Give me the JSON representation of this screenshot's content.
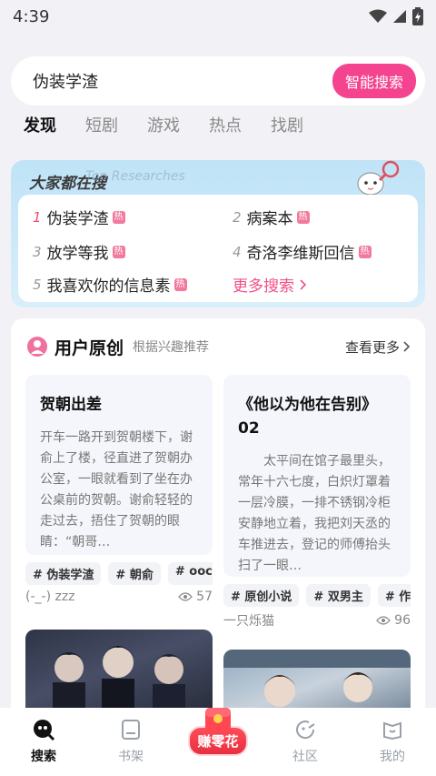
{
  "status_bar": {
    "time": "4:39"
  },
  "search": {
    "query": "伪装学渣",
    "button_label": "智能搜索"
  },
  "tabs": [
    {
      "label": "发现",
      "active": true
    },
    {
      "label": "短剧"
    },
    {
      "label": "游戏"
    },
    {
      "label": "热点"
    },
    {
      "label": "找剧"
    }
  ],
  "hot": {
    "title": "大家都在搜",
    "watermark": "Top Researches",
    "badge": "热",
    "items": [
      {
        "rank": "1",
        "text": "伪装学渣"
      },
      {
        "rank": "2",
        "text": "病案本"
      },
      {
        "rank": "3",
        "text": "放学等我"
      },
      {
        "rank": "4",
        "text": "奇洛李维斯回信"
      },
      {
        "rank": "5",
        "text": "我喜欢你的信息素"
      }
    ],
    "more": "更多搜索"
  },
  "ugc": {
    "title": "用户原创",
    "subtitle": "根据兴趣推荐",
    "more": "查看更多",
    "stories": [
      {
        "title": "贺朝出差",
        "body": "开车一路开到贺朝楼下，谢俞上了楼，径直进了贺朝办公室，一眼就看到了坐在办公桌前的贺朝。谢俞轻轻的走过去，捂住了贺朝的眼睛：“朝哥…",
        "tags": [
          "# 伪装学渣",
          "# 朝俞",
          "# ooc"
        ],
        "author": "(-_-) zzz",
        "views": "57"
      },
      {
        "title": "《他以为他在告别》02",
        "body": "太平间在馆子最里头，常年十六七度，白炽灯罩着一层冷膜，一排不锈钢冷柜安静地立着，我把刘天丞的车推进去，登记的师傅抬头扫了一眼…",
        "tags": [
          "# 原创小说",
          "# 双男主",
          "# 作"
        ],
        "author": "一只烁猫",
        "views": "96"
      }
    ]
  },
  "nav": {
    "items": [
      {
        "label": "搜索",
        "icon": "search-icon",
        "active": true
      },
      {
        "label": "书架",
        "icon": "bookshelf-icon"
      },
      {
        "label": "赚零花",
        "icon": "red-packet-icon"
      },
      {
        "label": "社区",
        "icon": "community-icon"
      },
      {
        "label": "我的",
        "icon": "profile-icon"
      }
    ]
  },
  "colors": {
    "accent": "#f4448f",
    "hot_rank": "#f0506e",
    "card_blue": "#bfe3f7"
  }
}
